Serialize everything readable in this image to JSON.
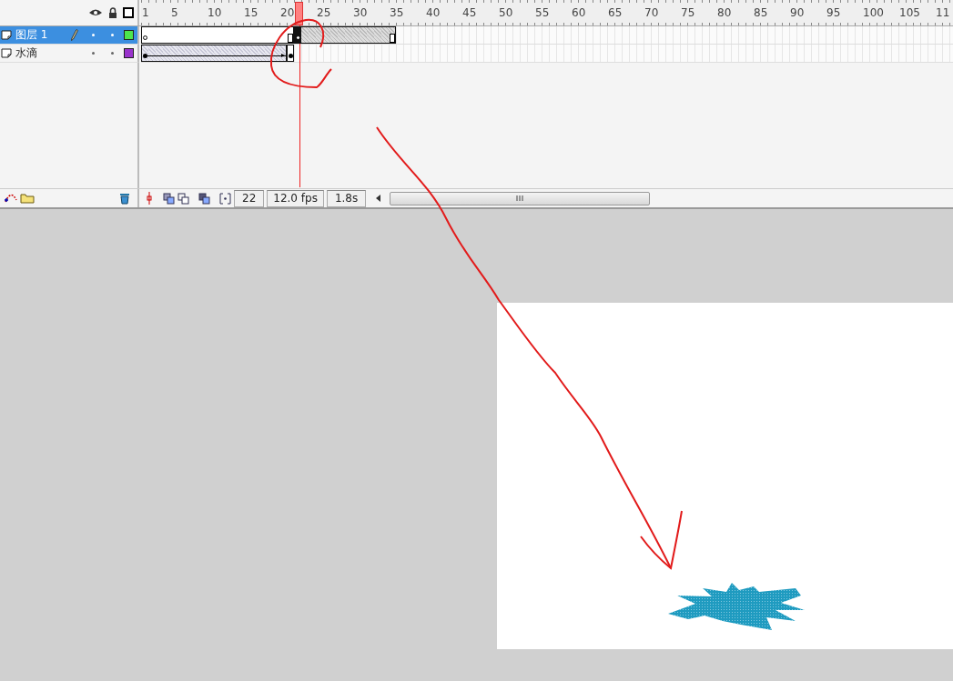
{
  "timeline": {
    "ruler": [
      "1",
      "5",
      "10",
      "15",
      "20",
      "25",
      "30",
      "35",
      "40",
      "45",
      "50",
      "55",
      "60",
      "65",
      "70",
      "75",
      "80",
      "85",
      "90",
      "95",
      "100",
      "105",
      "11"
    ],
    "layers": [
      {
        "name": "图层 1",
        "selected": true,
        "editing": true,
        "color": "#4ce64c",
        "frames": [
          {
            "kind": "blank_key"
          },
          {
            "kind": "blank"
          },
          {
            "kind": "blank"
          },
          {
            "kind": "blank"
          },
          {
            "kind": "blank"
          },
          {
            "kind": "blank"
          },
          {
            "kind": "blank"
          },
          {
            "kind": "blank"
          },
          {
            "kind": "blank"
          },
          {
            "kind": "blank"
          },
          {
            "kind": "blank"
          },
          {
            "kind": "blank"
          },
          {
            "kind": "blank"
          },
          {
            "kind": "blank"
          },
          {
            "kind": "blank"
          },
          {
            "kind": "blank"
          },
          {
            "kind": "blank"
          },
          {
            "kind": "blank"
          },
          {
            "kind": "blank"
          },
          {
            "kind": "blank"
          },
          {
            "kind": "blank_end"
          },
          {
            "kind": "current_key"
          },
          {
            "kind": "sel"
          },
          {
            "kind": "sel"
          },
          {
            "kind": "sel"
          },
          {
            "kind": "sel"
          },
          {
            "kind": "sel"
          },
          {
            "kind": "sel"
          },
          {
            "kind": "sel"
          },
          {
            "kind": "sel"
          },
          {
            "kind": "sel"
          },
          {
            "kind": "sel"
          },
          {
            "kind": "sel"
          },
          {
            "kind": "sel"
          },
          {
            "kind": "sel_end"
          }
        ]
      },
      {
        "name": "水滴",
        "selected": false,
        "editing": false,
        "color": "#9933cc",
        "frames": [
          {
            "kind": "tween_key"
          },
          {
            "kind": "tween"
          },
          {
            "kind": "tween"
          },
          {
            "kind": "tween"
          },
          {
            "kind": "tween"
          },
          {
            "kind": "tween"
          },
          {
            "kind": "tween"
          },
          {
            "kind": "tween"
          },
          {
            "kind": "tween"
          },
          {
            "kind": "tween"
          },
          {
            "kind": "tween"
          },
          {
            "kind": "tween"
          },
          {
            "kind": "tween"
          },
          {
            "kind": "tween"
          },
          {
            "kind": "tween"
          },
          {
            "kind": "tween"
          },
          {
            "kind": "tween"
          },
          {
            "kind": "tween"
          },
          {
            "kind": "tween"
          },
          {
            "kind": "tween_end"
          },
          {
            "kind": "key"
          }
        ]
      }
    ],
    "footer": {
      "frame": "22",
      "rate": "12.0 fps",
      "time": "1.8s"
    }
  }
}
